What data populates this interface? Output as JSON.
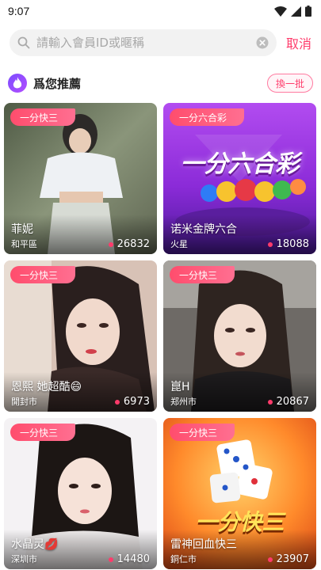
{
  "status": {
    "time": "9:07"
  },
  "search": {
    "placeholder": "請輸入會員ID或暱稱",
    "value": "",
    "cancel_label": "取消"
  },
  "section": {
    "title": "爲您推薦",
    "refresh_label": "換一批"
  },
  "colors": {
    "accent": "#ff3b6b",
    "tag": "#ff4d6d"
  },
  "cards": [
    {
      "tag": "一分快三",
      "name": "菲妮",
      "location": "和平區",
      "count": "26832",
      "theme": "photo-street"
    },
    {
      "tag": "一分六合彩",
      "name": "诺米金牌六合",
      "location": "火星",
      "count": "18088",
      "theme": "lottery",
      "banner": "一分六合彩"
    },
    {
      "tag": "一分快三",
      "name": "恩熙 她超酷😄",
      "location": "開封市",
      "count": "6973",
      "theme": "photo-room"
    },
    {
      "tag": "一分快三",
      "name": "崑H",
      "location": "郑州市",
      "count": "20867",
      "theme": "photo-car"
    },
    {
      "tag": "一分快三",
      "name": "水晶灵💋",
      "location": "深圳市",
      "count": "14480",
      "theme": "photo-white"
    },
    {
      "tag": "一分快三",
      "name": "雷神回血快三",
      "location": "銅仁市",
      "count": "23907",
      "theme": "dice",
      "banner": "一分快三"
    }
  ]
}
